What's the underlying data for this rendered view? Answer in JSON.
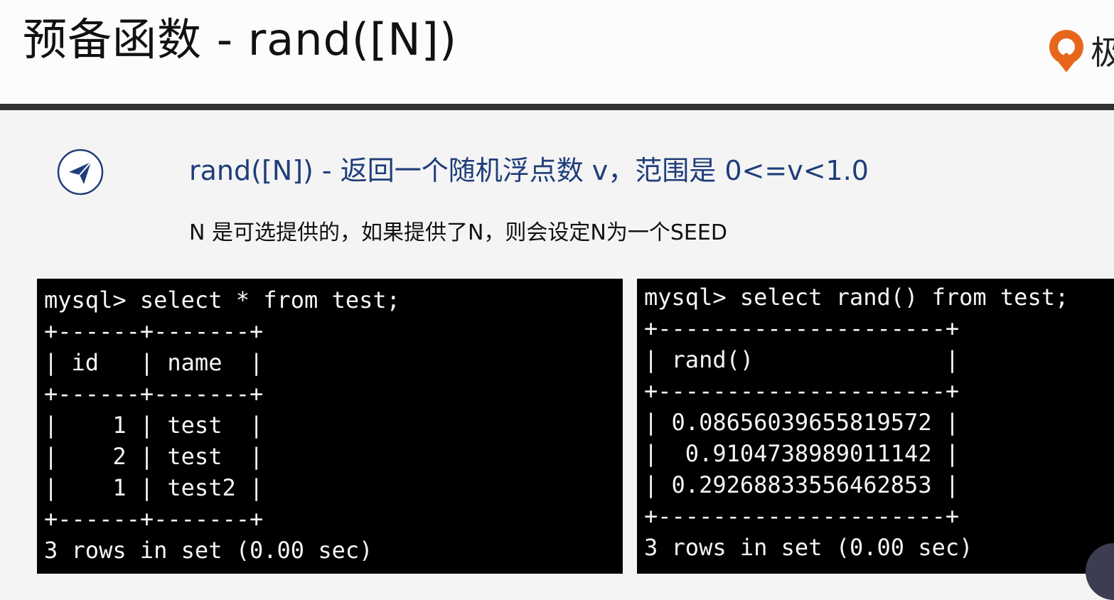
{
  "slide": {
    "title": "预备函数 - rand([N])",
    "logo_text": "极",
    "heading": "rand([N]) - 返回一个随机浮点数 v，范围是 0<=v<1.0",
    "description": "N 是可选提供的，如果提供了N，则会设定N为一个SEED",
    "icon": "paper-plane-icon",
    "colors": {
      "heading": "#1f3d7a",
      "logo": "#e8661c",
      "terminal_bg": "#000000",
      "rule": "#333333"
    }
  },
  "terminal_left": {
    "lines": [
      "mysql> select * from test;",
      "+------+-------+",
      "| id   | name  |",
      "+------+-------+",
      "|    1 | test  |",
      "|    2 | test  |",
      "|    1 | test2 |",
      "+------+-------+",
      "3 rows in set (0.00 sec)"
    ]
  },
  "terminal_right": {
    "lines": [
      "mysql> select rand() from test;",
      "+---------------------+",
      "| rand()              |",
      "+---------------------+",
      "| 0.08656039655819572 |",
      "|  0.9104738989011142 |",
      "| 0.29268833556462853 |",
      "+---------------------+",
      "3 rows in set (0.00 sec)"
    ]
  }
}
